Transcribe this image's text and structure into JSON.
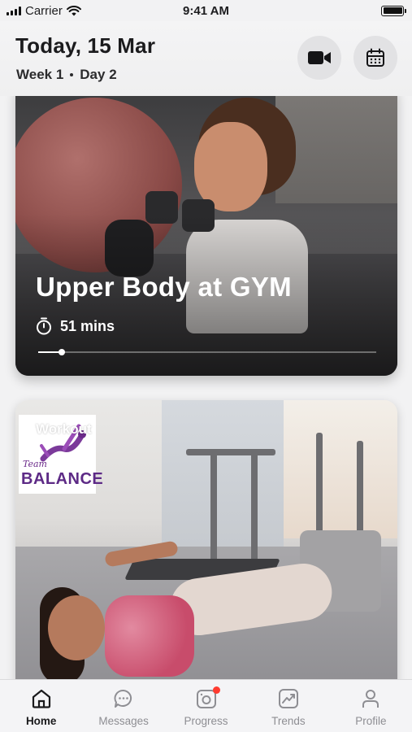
{
  "status_bar": {
    "carrier": "Carrier",
    "time": "9:41 AM"
  },
  "header": {
    "date": "Today, 15 Mar",
    "week": "Week 1",
    "day": "Day 2",
    "video_icon": "video-camera-icon",
    "calendar_icon": "calendar-icon"
  },
  "cards": [
    {
      "title": "Upper Body at GYM",
      "duration": "51 mins",
      "progress": 0.07,
      "timer_icon": "stopwatch-icon"
    },
    {
      "label": "Workout",
      "logo_script": "Team",
      "logo_word": "BALANCE"
    }
  ],
  "tabbar": {
    "active_color": "#1a1a1c",
    "inactive_color": "#8e8e93",
    "badge_color": "#ff3b30",
    "items": [
      {
        "label": "Home",
        "icon": "home-icon"
      },
      {
        "label": "Messages",
        "icon": "chat-bubble-icon"
      },
      {
        "label": "Progress",
        "icon": "progress-camera-icon"
      },
      {
        "label": "Trends",
        "icon": "trends-chart-icon"
      },
      {
        "label": "Profile",
        "icon": "person-icon"
      }
    ]
  }
}
